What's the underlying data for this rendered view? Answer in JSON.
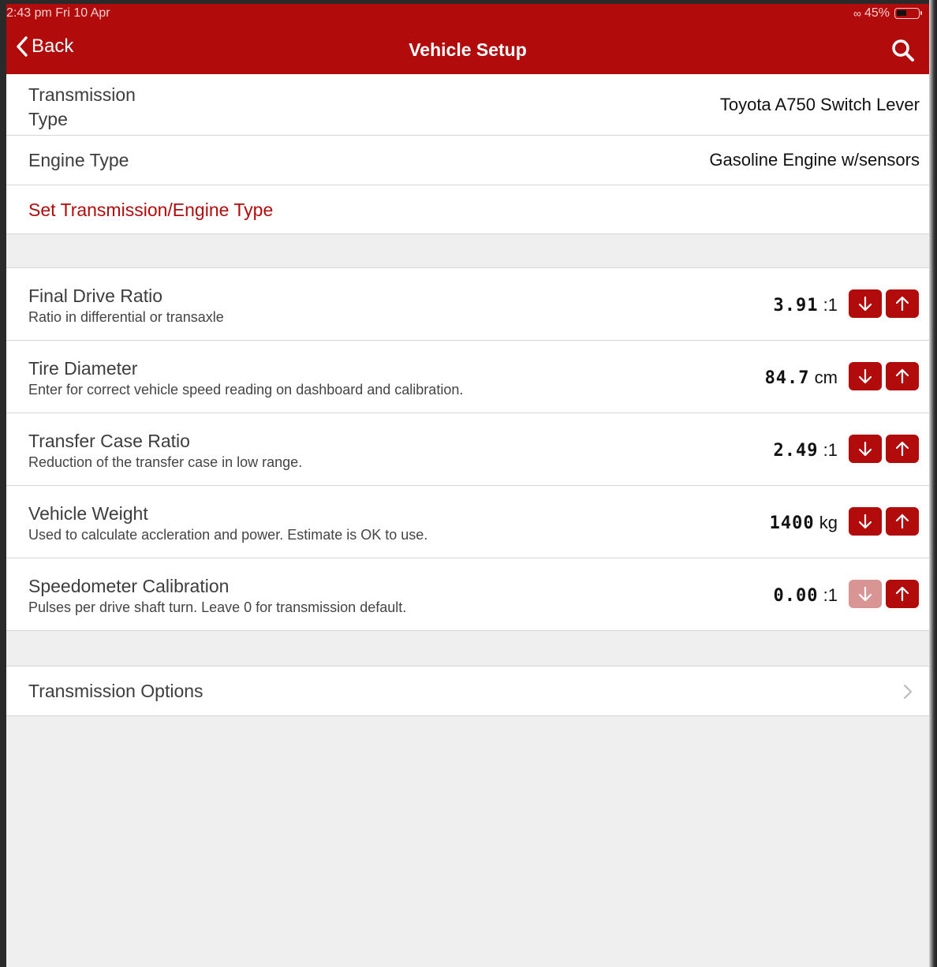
{
  "status": {
    "time": "2:43 pm  Fri 10 Apr",
    "battery": "45%"
  },
  "nav": {
    "back_label": "Back",
    "title": "Vehicle Setup"
  },
  "type_section": {
    "transmission_label_line1": "Transmission",
    "transmission_label_line2": "Type",
    "transmission_value": "Toyota A750 Switch Lever",
    "engine_label": "Engine Type",
    "engine_value": "Gasoline Engine w/sensors",
    "set_action": "Set Transmission/Engine Type"
  },
  "params": [
    {
      "title": "Final Drive Ratio",
      "subtitle": "Ratio in differential or transaxle",
      "value": "3.91",
      "unit": ":1",
      "down_enabled": true
    },
    {
      "title": "Tire Diameter",
      "subtitle": "Enter for correct vehicle speed reading on dashboard and calibration.",
      "value": "84.7",
      "unit": "cm",
      "down_enabled": true
    },
    {
      "title": "Transfer Case Ratio",
      "subtitle": "Reduction of the transfer case in low range.",
      "value": "2.49",
      "unit": ":1",
      "down_enabled": true
    },
    {
      "title": "Vehicle Weight",
      "subtitle": "Used to calculate accleration and power. Estimate is OK to use.",
      "value": "1400",
      "unit": "kg",
      "down_enabled": true
    },
    {
      "title": "Speedometer Calibration",
      "subtitle": "Pulses per drive shaft turn. Leave 0 for transmission default.",
      "value": "0.00",
      "unit": ":1",
      "down_enabled": false
    }
  ],
  "options": {
    "label": "Transmission Options"
  },
  "colors": {
    "accent": "#b10b0b",
    "disabled": "#d99494",
    "background": "#efefef"
  }
}
